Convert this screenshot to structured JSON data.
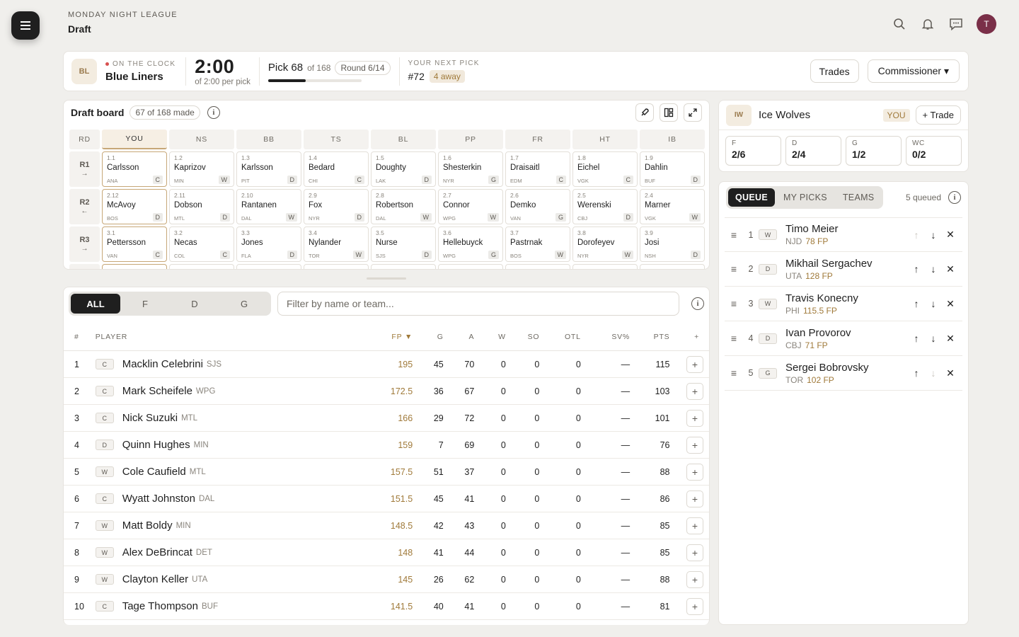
{
  "header": {
    "league": "MONDAY NIGHT LEAGUE",
    "page": "Draft",
    "avatar_initial": "T"
  },
  "clock": {
    "team_badge": "BL",
    "on_the_clock_label": "ON THE CLOCK",
    "team_name": "Blue Liners",
    "time": "2:00",
    "per_pick": "of 2:00 per pick",
    "pick_label": "Pick 68",
    "pick_of": "of 168",
    "round": "Round 6/14",
    "pick_progress": 0.4,
    "next_pick_label": "YOUR NEXT PICK",
    "next_pick": "#72",
    "away": "4 away",
    "trades_button": "Trades",
    "commissioner_button": "Commissioner ▾"
  },
  "board": {
    "title": "Draft board",
    "made": "67 of 168 made",
    "rd_label": "RD",
    "columns": [
      "YOU",
      "NS",
      "BB",
      "TS",
      "BL",
      "PP",
      "FR",
      "HT",
      "IB"
    ],
    "rounds": [
      {
        "label": "R1",
        "arrow": "→",
        "picks": [
          {
            "n": "1.1",
            "name": "Carlsson",
            "team": "ANA",
            "pos": "C"
          },
          {
            "n": "1.2",
            "name": "Kaprizov",
            "team": "MIN",
            "pos": "W"
          },
          {
            "n": "1.3",
            "name": "Karlsson",
            "team": "PIT",
            "pos": "D"
          },
          {
            "n": "1.4",
            "name": "Bedard",
            "team": "CHI",
            "pos": "C"
          },
          {
            "n": "1.5",
            "name": "Doughty",
            "team": "LAK",
            "pos": "D"
          },
          {
            "n": "1.6",
            "name": "Shesterkin",
            "team": "NYR",
            "pos": "G"
          },
          {
            "n": "1.7",
            "name": "Draisaitl",
            "team": "EDM",
            "pos": "C"
          },
          {
            "n": "1.8",
            "name": "Eichel",
            "team": "VGK",
            "pos": "C"
          },
          {
            "n": "1.9",
            "name": "Dahlin",
            "team": "BUF",
            "pos": "D"
          }
        ]
      },
      {
        "label": "R2",
        "arrow": "←",
        "picks": [
          {
            "n": "2.12",
            "name": "McAvoy",
            "team": "BOS",
            "pos": "D"
          },
          {
            "n": "2.11",
            "name": "Dobson",
            "team": "MTL",
            "pos": "D"
          },
          {
            "n": "2.10",
            "name": "Rantanen",
            "team": "DAL",
            "pos": "W"
          },
          {
            "n": "2.9",
            "name": "Fox",
            "team": "NYR",
            "pos": "D"
          },
          {
            "n": "2.8",
            "name": "Robertson",
            "team": "DAL",
            "pos": "W"
          },
          {
            "n": "2.7",
            "name": "Connor",
            "team": "WPG",
            "pos": "W"
          },
          {
            "n": "2.6",
            "name": "Demko",
            "team": "VAN",
            "pos": "G"
          },
          {
            "n": "2.5",
            "name": "Werenski",
            "team": "CBJ",
            "pos": "D"
          },
          {
            "n": "2.4",
            "name": "Marner",
            "team": "VGK",
            "pos": "W"
          }
        ]
      },
      {
        "label": "R3",
        "arrow": "→",
        "picks": [
          {
            "n": "3.1",
            "name": "Pettersson",
            "team": "VAN",
            "pos": "C"
          },
          {
            "n": "3.2",
            "name": "Necas",
            "team": "COL",
            "pos": "C"
          },
          {
            "n": "3.3",
            "name": "Jones",
            "team": "FLA",
            "pos": "D"
          },
          {
            "n": "3.4",
            "name": "Nylander",
            "team": "TOR",
            "pos": "W"
          },
          {
            "n": "3.5",
            "name": "Nurse",
            "team": "SJS",
            "pos": "D"
          },
          {
            "n": "3.6",
            "name": "Hellebuyck",
            "team": "WPG",
            "pos": "G"
          },
          {
            "n": "3.7",
            "name": "Pastrnak",
            "team": "BOS",
            "pos": "W"
          },
          {
            "n": "3.8",
            "name": "Dorofeyev",
            "team": "NYR",
            "pos": "W"
          },
          {
            "n": "3.9",
            "name": "Josi",
            "team": "NSH",
            "pos": "D"
          }
        ]
      }
    ]
  },
  "players": {
    "filters": [
      "ALL",
      "F",
      "D",
      "G"
    ],
    "search_placeholder": "Filter by name or team...",
    "headers": {
      "num": "#",
      "player": "PLAYER",
      "fp": "FP ▼",
      "g": "G",
      "a": "A",
      "w": "W",
      "so": "SO",
      "otl": "OTL",
      "sv": "SV%",
      "pts": "PTS",
      "add": "+"
    },
    "rows": [
      {
        "num": "1",
        "pos": "C",
        "name": "Macklin Celebrini",
        "team": "SJS",
        "fp": "195",
        "g": "45",
        "a": "70",
        "w": "0",
        "so": "0",
        "otl": "0",
        "sv": "—",
        "pts": "115"
      },
      {
        "num": "2",
        "pos": "C",
        "name": "Mark Scheifele",
        "team": "WPG",
        "fp": "172.5",
        "g": "36",
        "a": "67",
        "w": "0",
        "so": "0",
        "otl": "0",
        "sv": "—",
        "pts": "103"
      },
      {
        "num": "3",
        "pos": "C",
        "name": "Nick Suzuki",
        "team": "MTL",
        "fp": "166",
        "g": "29",
        "a": "72",
        "w": "0",
        "so": "0",
        "otl": "0",
        "sv": "—",
        "pts": "101"
      },
      {
        "num": "4",
        "pos": "D",
        "name": "Quinn Hughes",
        "team": "MIN",
        "fp": "159",
        "g": "7",
        "a": "69",
        "w": "0",
        "so": "0",
        "otl": "0",
        "sv": "—",
        "pts": "76"
      },
      {
        "num": "5",
        "pos": "W",
        "name": "Cole Caufield",
        "team": "MTL",
        "fp": "157.5",
        "g": "51",
        "a": "37",
        "w": "0",
        "so": "0",
        "otl": "0",
        "sv": "—",
        "pts": "88"
      },
      {
        "num": "6",
        "pos": "C",
        "name": "Wyatt Johnston",
        "team": "DAL",
        "fp": "151.5",
        "g": "45",
        "a": "41",
        "w": "0",
        "so": "0",
        "otl": "0",
        "sv": "—",
        "pts": "86"
      },
      {
        "num": "7",
        "pos": "W",
        "name": "Matt Boldy",
        "team": "MIN",
        "fp": "148.5",
        "g": "42",
        "a": "43",
        "w": "0",
        "so": "0",
        "otl": "0",
        "sv": "—",
        "pts": "85"
      },
      {
        "num": "8",
        "pos": "W",
        "name": "Alex DeBrincat",
        "team": "DET",
        "fp": "148",
        "g": "41",
        "a": "44",
        "w": "0",
        "so": "0",
        "otl": "0",
        "sv": "—",
        "pts": "85"
      },
      {
        "num": "9",
        "pos": "W",
        "name": "Clayton Keller",
        "team": "UTA",
        "fp": "145",
        "g": "26",
        "a": "62",
        "w": "0",
        "so": "0",
        "otl": "0",
        "sv": "—",
        "pts": "88"
      },
      {
        "num": "10",
        "pos": "C",
        "name": "Tage Thompson",
        "team": "BUF",
        "fp": "141.5",
        "g": "40",
        "a": "41",
        "w": "0",
        "so": "0",
        "otl": "0",
        "sv": "—",
        "pts": "81"
      }
    ]
  },
  "team": {
    "badge": "IW",
    "name": "Ice Wolves",
    "you": "YOU",
    "trade_button": "+ Trade",
    "slots": [
      {
        "k": "F",
        "v": "2/6"
      },
      {
        "k": "D",
        "v": "2/4"
      },
      {
        "k": "G",
        "v": "1/2"
      },
      {
        "k": "WC",
        "v": "0/2"
      }
    ]
  },
  "queue": {
    "tabs": [
      "QUEUE",
      "MY PICKS",
      "TEAMS"
    ],
    "count": "5 queued",
    "items": [
      {
        "n": "1",
        "pos": "W",
        "name": "Timo Meier",
        "team": "NJD",
        "fp": "78 FP",
        "up_enabled": false,
        "down_enabled": true
      },
      {
        "n": "2",
        "pos": "D",
        "name": "Mikhail Sergachev",
        "team": "UTA",
        "fp": "128 FP",
        "up_enabled": true,
        "down_enabled": true
      },
      {
        "n": "3",
        "pos": "W",
        "name": "Travis Konecny",
        "team": "PHI",
        "fp": "115.5 FP",
        "up_enabled": true,
        "down_enabled": true
      },
      {
        "n": "4",
        "pos": "D",
        "name": "Ivan Provorov",
        "team": "CBJ",
        "fp": "71 FP",
        "up_enabled": true,
        "down_enabled": true
      },
      {
        "n": "5",
        "pos": "G",
        "name": "Sergei Bobrovsky",
        "team": "TOR",
        "fp": "102 FP",
        "up_enabled": true,
        "down_enabled": false
      }
    ]
  }
}
